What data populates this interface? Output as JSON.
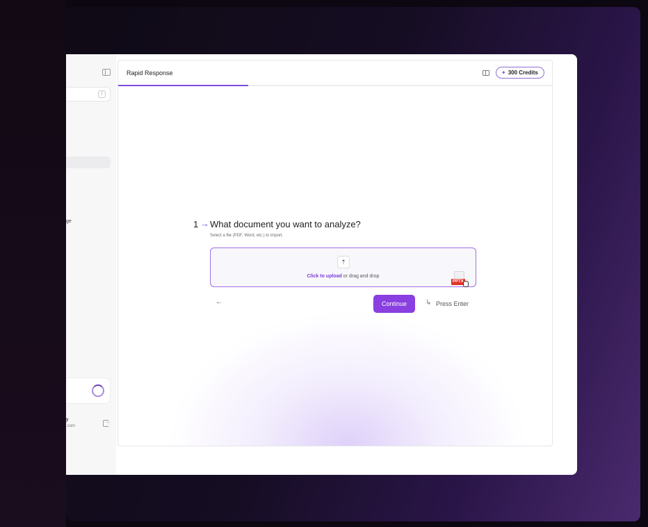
{
  "sidebar": {
    "search_shortcut": "/",
    "partial_nav_text": "ge",
    "user_name_partial": "y",
    "user_email_partial": ".com"
  },
  "topbar": {
    "title": "Rapid Response",
    "credits_label": "300 Credits"
  },
  "progress": {
    "fraction": 0.3
  },
  "question": {
    "number": "1",
    "arrow": "→",
    "text": "What document you want to analyze?",
    "subtext": "Select a file (PDF, Word, etc.) to import."
  },
  "upload": {
    "link_text": "Click to upload",
    "rest_text": " or drag and drop",
    "file_badge": "PPTX"
  },
  "actions": {
    "back": "←",
    "continue": "Continue",
    "enter_hint": "Press Enter"
  },
  "colors": {
    "accent": "#8a3fe0",
    "progress": "#7b4ddb",
    "badge": "#e0352b"
  },
  "icons": [
    "sidebar-toggle-icon",
    "panel-icon",
    "sparkle-icon",
    "upload-cloud-icon",
    "pptx-file-icon",
    "back-arrow-icon",
    "enter-key-icon",
    "logout-icon",
    "loading-ring-icon"
  ]
}
